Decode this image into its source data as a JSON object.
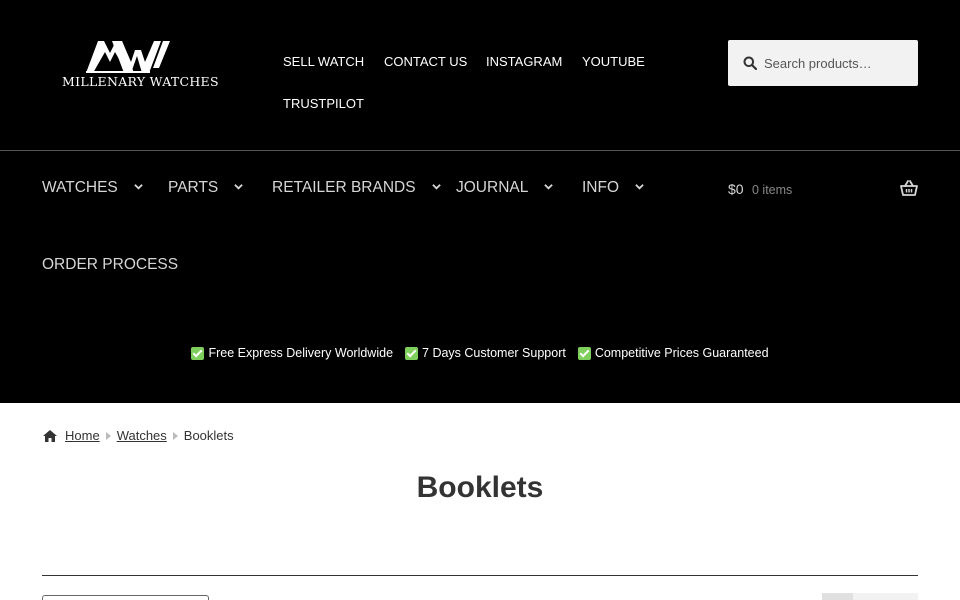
{
  "brand": {
    "name": "MILLENARY WATCHES"
  },
  "toplinks": [
    {
      "label": "SELL WATCH"
    },
    {
      "label": "CONTACT US"
    },
    {
      "label": "INSTAGRAM"
    },
    {
      "label": "YOUTUBE"
    },
    {
      "label": "TRUSTPILOT"
    }
  ],
  "search": {
    "placeholder": "Search products…",
    "icon": "search-icon"
  },
  "nav": {
    "items": [
      {
        "label": "WATCHES"
      },
      {
        "label": "PARTS"
      },
      {
        "label": "RETAILER BRANDS"
      },
      {
        "label": "JOURNAL"
      },
      {
        "label": "INFO"
      },
      {
        "label": "ORDER PROCESS"
      }
    ]
  },
  "cart": {
    "total": "$0",
    "count": "0 items",
    "icon": "basket-icon"
  },
  "usps": [
    {
      "label": "Free Express Delivery Worldwide"
    },
    {
      "label": "7 Days Customer Support"
    },
    {
      "label": "Competitive Prices Guaranteed"
    }
  ],
  "breadcrumb": {
    "home": "Home",
    "watches": "Watches",
    "current": "Booklets"
  },
  "page": {
    "title": "Booklets"
  },
  "colors": {
    "header_bg": "#000000",
    "nav_text": "#d6d6d6",
    "check_green": "#7fcf5c",
    "text": "#333333"
  }
}
